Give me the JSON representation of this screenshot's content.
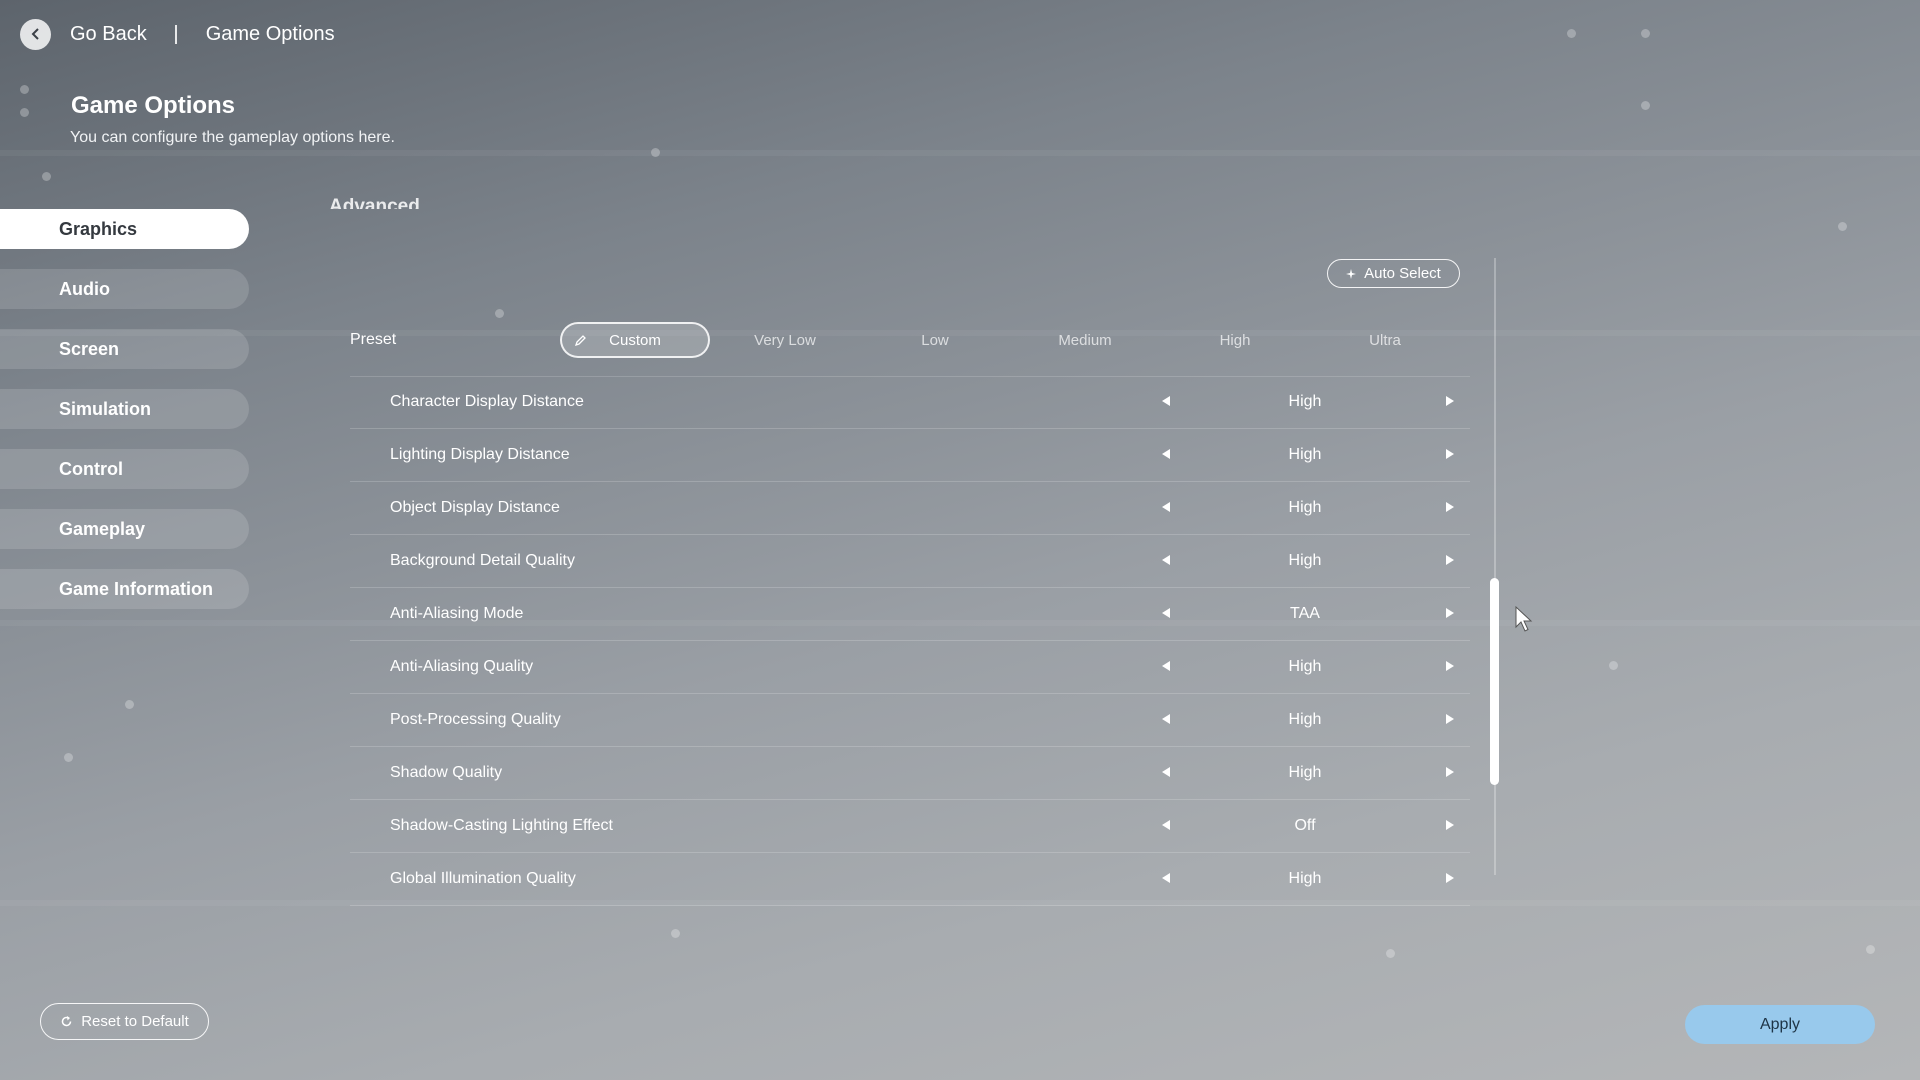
{
  "topbar": {
    "back_label": "Go Back",
    "breadcrumb": "Game Options"
  },
  "header": {
    "title": "Game Options",
    "subtitle": "You can configure the gameplay options here."
  },
  "sidebar": {
    "items": [
      {
        "label": "Graphics",
        "active": true
      },
      {
        "label": "Audio"
      },
      {
        "label": "Screen"
      },
      {
        "label": "Simulation"
      },
      {
        "label": "Control"
      },
      {
        "label": "Gameplay"
      },
      {
        "label": "Game Information"
      }
    ]
  },
  "section": {
    "label": "Advanced"
  },
  "auto_select": {
    "label": "Auto Select",
    "icon": "sparkle-icon"
  },
  "preset": {
    "label": "Preset",
    "options": [
      "Custom",
      "Very Low",
      "Low",
      "Medium",
      "High",
      "Ultra"
    ],
    "selected": "Custom"
  },
  "settings": [
    {
      "label": "Character Display Distance",
      "value": "High"
    },
    {
      "label": "Lighting Display Distance",
      "value": "High"
    },
    {
      "label": "Object Display Distance",
      "value": "High"
    },
    {
      "label": "Background Detail Quality",
      "value": "High"
    },
    {
      "label": "Anti-Aliasing Mode",
      "value": "TAA"
    },
    {
      "label": "Anti-Aliasing Quality",
      "value": "High"
    },
    {
      "label": "Post-Processing Quality",
      "value": "High"
    },
    {
      "label": "Shadow Quality",
      "value": "High"
    },
    {
      "label": "Shadow-Casting Lighting Effect",
      "value": "Off"
    },
    {
      "label": "Global Illumination Quality",
      "value": "High"
    }
  ],
  "bottom": {
    "reset_label": "Reset to Default",
    "apply_label": "Apply"
  },
  "colors": {
    "apply_button": "#98c9ec",
    "active_tab_bg": "#ffffff",
    "active_tab_text": "#34393f"
  }
}
